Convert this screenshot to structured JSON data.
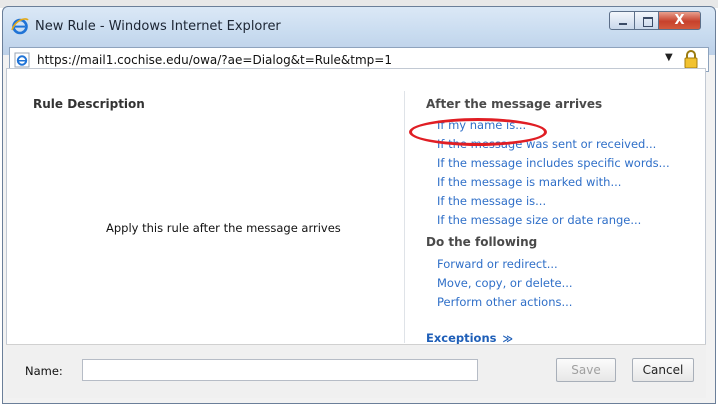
{
  "window": {
    "title": "New Rule - Windows Internet Explorer",
    "close_glyph": "X"
  },
  "addressbar": {
    "url": "https://mail1.cochise.edu/owa/?ae=Dialog&t=Rule&tmp=1",
    "dropdown_glyph": "▼"
  },
  "left_panel": {
    "title": "Rule Description",
    "description": "Apply this rule after the message arrives"
  },
  "right_panel": {
    "after_heading": "After the message arrives",
    "conditions": [
      "If my name is...",
      "If the message was sent or received...",
      "If the message includes specific words...",
      "If the message is marked with...",
      "If the message is...",
      "If the message size or date range..."
    ],
    "do_heading": "Do the following",
    "actions": [
      "Forward or redirect...",
      "Move, copy, or delete...",
      "Perform other actions..."
    ],
    "exceptions_label": "Exceptions",
    "exceptions_glyph": "≫"
  },
  "footer": {
    "name_label": "Name:",
    "name_value": "",
    "save_label": "Save",
    "cancel_label": "Cancel"
  },
  "colors": {
    "link": "#2f6fc8",
    "highlight": "#e01e24"
  },
  "icons": {
    "browser": "ie-logo-icon",
    "address": "ie-page-icon",
    "security": "lock-icon"
  }
}
